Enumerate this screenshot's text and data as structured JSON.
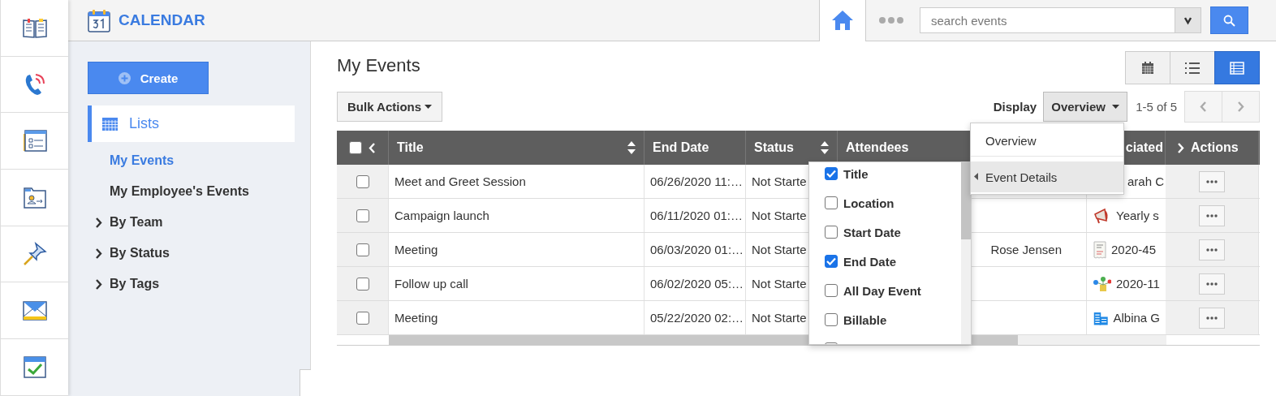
{
  "rail": [
    {
      "kind": "book"
    },
    {
      "kind": "phone"
    },
    {
      "kind": "form"
    },
    {
      "kind": "folder"
    },
    {
      "kind": "pin"
    },
    {
      "kind": "mail"
    },
    {
      "kind": "task"
    }
  ],
  "app": {
    "title": "CALENDAR"
  },
  "topbar": {
    "search": {
      "placeholder": "search events"
    }
  },
  "sidebar": {
    "create": "Create",
    "lists": "Lists",
    "items": [
      {
        "label": "My Events",
        "kind": "link",
        "selected": true
      },
      {
        "label": "My Employee's Events",
        "kind": "link",
        "selected": false
      },
      {
        "label": "By Team",
        "kind": "group",
        "selected": false,
        "expanded": false
      },
      {
        "label": "By Status",
        "kind": "group",
        "selected": false,
        "expanded": false
      },
      {
        "label": "By Tags",
        "kind": "group",
        "selected": false,
        "expanded": false
      }
    ]
  },
  "page": {
    "title": "My Events",
    "views": [
      {
        "kind": "calendar",
        "selected": false
      },
      {
        "kind": "list",
        "selected": false
      },
      {
        "kind": "table",
        "selected": true
      }
    ],
    "bulk_actions": "Bulk Actions",
    "display_label": "Display",
    "display_value": "Overview",
    "pagination": "1-5 of 5"
  },
  "table": {
    "all_checked": false,
    "columns": [
      {
        "label": "Title",
        "sortable": true
      },
      {
        "label": "End Date",
        "sortable": false
      },
      {
        "label": "Status",
        "sortable": true
      },
      {
        "label": "Attendees",
        "sortable": false
      },
      {
        "label": "ciated",
        "sortable": false
      },
      {
        "label": "Actions",
        "sortable": false
      }
    ],
    "rows": [
      {
        "checked": false,
        "title": "Meet and Greet Session",
        "end_date": "06/26/2020 11:…",
        "status": "Not Starte",
        "associated": "arah C"
      },
      {
        "checked": false,
        "title": "Campaign launch",
        "end_date": "06/11/2020 01:…",
        "status": "Not Starte",
        "associated": "Yearly s",
        "kind": "megaphone"
      },
      {
        "checked": false,
        "title": "Meeting",
        "end_date": "06/03/2020 01:…",
        "status": "Not Starte",
        "attendees": "Rose Jensen",
        "associated": "2020-45",
        "kind": "receipt"
      },
      {
        "checked": false,
        "title": "Follow up call",
        "end_date": "06/02/2020 05:…",
        "status": "Not Starte",
        "associated": "2020-11",
        "kind": "network"
      },
      {
        "checked": false,
        "title": "Meeting",
        "end_date": "05/22/2020 02:…",
        "status": "Not Starte",
        "associated": "Albina G",
        "kind": "building"
      }
    ]
  },
  "display_menu": {
    "items": [
      {
        "label": "Overview",
        "expanded": false
      },
      {
        "label": "Event Details",
        "expanded": true
      }
    ]
  },
  "column_chooser": {
    "items": [
      {
        "label": "Title",
        "checked": true
      },
      {
        "label": "Location",
        "checked": false
      },
      {
        "label": "Start Date",
        "checked": false
      },
      {
        "label": "End Date",
        "checked": true
      },
      {
        "label": "All Day Event",
        "checked": false
      },
      {
        "label": "Billable",
        "checked": false
      },
      {
        "checked": false
      }
    ]
  }
}
